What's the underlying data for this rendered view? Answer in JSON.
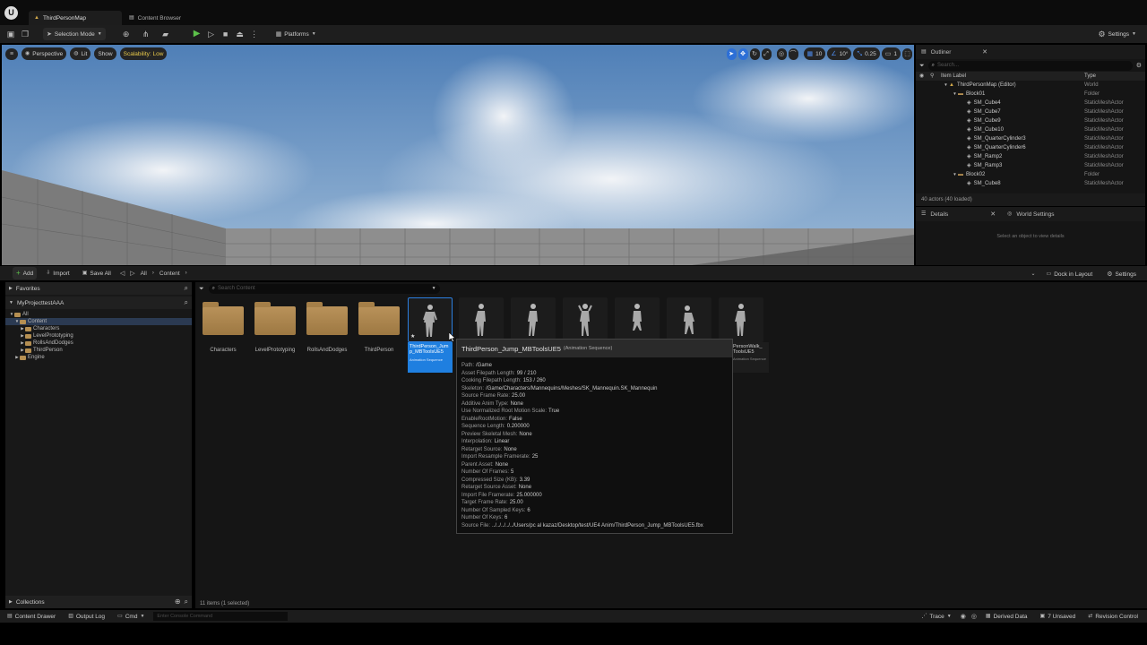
{
  "tabs": [
    "ThirdPersonMap",
    "Content Browser"
  ],
  "toolbar": {
    "selection_mode": "Selection Mode",
    "platforms": "Platforms",
    "settings": "Settings"
  },
  "viewport": {
    "perspective": "Perspective",
    "lit": "Lit",
    "show": "Show",
    "scalability": "Scalability: Low",
    "grid_value": "10",
    "angle_value": "10°",
    "scale_value": "0.25",
    "camera_speed": "1"
  },
  "outliner": {
    "title": "Outliner",
    "search_placeholder": "Search...",
    "col_label": "Item Label",
    "col_type": "Type",
    "rows": [
      {
        "label": "ThirdPersonMap (Editor)",
        "type": "World",
        "indent": 0,
        "icon": "world"
      },
      {
        "label": "Block01",
        "type": "Folder",
        "indent": 1,
        "icon": "folder"
      },
      {
        "label": "SM_Cube4",
        "type": "StaticMeshActor",
        "indent": 2,
        "icon": "mesh"
      },
      {
        "label": "SM_Cube7",
        "type": "StaticMeshActor",
        "indent": 2,
        "icon": "mesh"
      },
      {
        "label": "SM_Cube9",
        "type": "StaticMeshActor",
        "indent": 2,
        "icon": "mesh"
      },
      {
        "label": "SM_Cube10",
        "type": "StaticMeshActor",
        "indent": 2,
        "icon": "mesh"
      },
      {
        "label": "SM_QuarterCylinder3",
        "type": "StaticMeshActor",
        "indent": 2,
        "icon": "mesh"
      },
      {
        "label": "SM_QuarterCylinder6",
        "type": "StaticMeshActor",
        "indent": 2,
        "icon": "mesh"
      },
      {
        "label": "SM_Ramp2",
        "type": "StaticMeshActor",
        "indent": 2,
        "icon": "mesh"
      },
      {
        "label": "SM_Ramp3",
        "type": "StaticMeshActor",
        "indent": 2,
        "icon": "mesh"
      },
      {
        "label": "Block02",
        "type": "Folder",
        "indent": 1,
        "icon": "folder"
      },
      {
        "label": "SM_Cube8",
        "type": "StaticMeshActor",
        "indent": 2,
        "icon": "mesh"
      }
    ],
    "footer": "40 actors (40 loaded)"
  },
  "details": {
    "tab_details": "Details",
    "tab_world": "World Settings",
    "empty": "Select an object to view details"
  },
  "content_browser": {
    "add": "Add",
    "import": "Import",
    "save_all": "Save All",
    "crumb_all": "All",
    "crumb_content": "Content",
    "dock": "Dock in Layout",
    "settings": "Settings",
    "favorites": "Favorites",
    "project": "MyProjecttestAAA",
    "tree": [
      {
        "label": "All",
        "indent": 0
      },
      {
        "label": "Content",
        "indent": 1
      },
      {
        "label": "Characters",
        "indent": 2
      },
      {
        "label": "LevelPrototyping",
        "indent": 2
      },
      {
        "label": "RollsAndDodges",
        "indent": 2
      },
      {
        "label": "ThirdPerson",
        "indent": 2
      },
      {
        "label": "Engine",
        "indent": 1
      }
    ],
    "collections": "Collections",
    "search_placeholder": "Search Content",
    "status": "11 items (1 selected)",
    "folders": [
      "Characters",
      "LevelPrototyping",
      "RollsAndDodges",
      "ThirdPerson"
    ],
    "selected_asset": {
      "name": "ThirdPerson_Jump_MBToolsUE5",
      "kind": "Animation Sequence"
    },
    "partial_asset": {
      "name": "PersonWalk_",
      "name2": "ToolsUE5",
      "kind": "Animation Sequence"
    }
  },
  "tooltip": {
    "title": "ThirdPerson_Jump_MBToolsUE5",
    "subtitle": "(Animation Sequence)",
    "props": [
      {
        "k": "Path:",
        "v": "/Game"
      },
      {
        "k": "Asset Filepath Length:",
        "v": "99 / 210"
      },
      {
        "k": "Cooking Filepath Length:",
        "v": "153 / 260"
      },
      {
        "k": "Skeleton:",
        "v": "/Game/Characters/Mannequins/Meshes/SK_Mannequin.SK_Mannequin"
      },
      {
        "k": "Source Frame Rate:",
        "v": "25.00"
      },
      {
        "k": "Additive Anim Type:",
        "v": "None"
      },
      {
        "k": "Use Normalized Root Motion Scale:",
        "v": "True"
      },
      {
        "k": "EnableRootMotion:",
        "v": "False"
      },
      {
        "k": "Sequence Length:",
        "v": "0.200000"
      },
      {
        "k": "Preview Skeletal Mesh:",
        "v": "None"
      },
      {
        "k": "Interpolation:",
        "v": "Linear"
      },
      {
        "k": "Retarget Source:",
        "v": "None"
      },
      {
        "k": "Import Resample Framerate:",
        "v": "25"
      },
      {
        "k": "Parent Asset:",
        "v": "None"
      },
      {
        "k": "Number Of Frames:",
        "v": "5"
      },
      {
        "k": "Compressed Size (KB):",
        "v": "3.39"
      },
      {
        "k": "Retarget Source Asset:",
        "v": "None"
      },
      {
        "k": "Import File Framerate:",
        "v": "25.000000"
      },
      {
        "k": "Target Frame Rate:",
        "v": "25.00"
      },
      {
        "k": "Number Of Sampled Keys:",
        "v": "6"
      },
      {
        "k": "Number Of Keys:",
        "v": "6"
      },
      {
        "k": "Source File:",
        "v": "../../../../../Users/pc al kazaz/Desktop/test/UE4 Anim/ThirdPerson_Jump_MBToolsUE5.fbx"
      }
    ]
  },
  "statusbar": {
    "content_drawer": "Content Drawer",
    "output_log": "Output Log",
    "cmd": "Cmd",
    "console_placeholder": "Enter Console Command",
    "trace": "Trace",
    "derived_data": "Derived Data",
    "unsaved": "7 Unsaved",
    "revision": "Revision Control"
  }
}
